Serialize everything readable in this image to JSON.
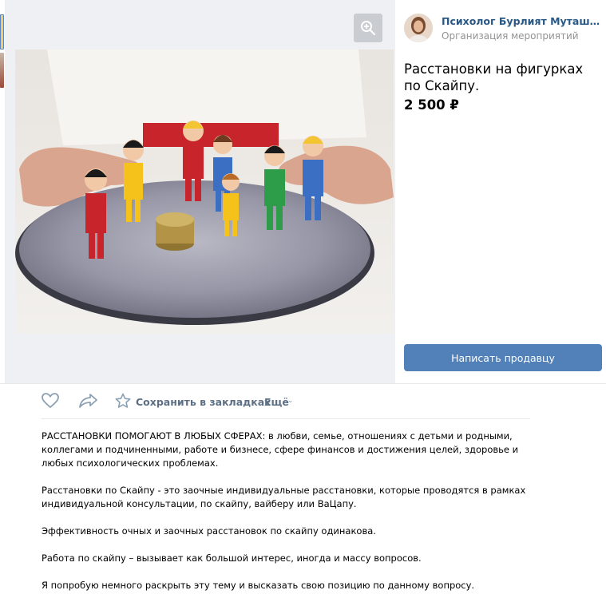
{
  "seller": {
    "name": "Психолог Бурлият Муташева г....",
    "subtitle": "Организация мероприятий"
  },
  "product": {
    "title": "Расстановки на фигурках по Скайпу.",
    "price": "2 500 ₽",
    "contact_button": "Написать продавцу"
  },
  "actions": {
    "like_icon": "heart-icon",
    "share_icon": "share-arrow-icon",
    "bookmark_icon": "star-icon",
    "bookmark_label": "Сохранить в закладках",
    "more_label": "Ещё"
  },
  "description": [
    "РАССТАНОВКИ ПОМОГАЮТ В ЛЮБЫХ СФЕРАХ: в любви, семье, отношениях с детьми и родными, коллегами и подчиненными, работе и бизнесе, сфере финансов и достижения целей, здоровье и любых психологических проблемах.",
    "Расстановки по Скайпу - это заочные индивидуальные расстановки, которые проводятся в рамках индивидуальной консультации, по скайпу, вайберу или ВаЦапу.",
    "Эффективность очных и заочных расстановок по скайпу одинакова.",
    "Работа по скайпу – вызывает как большой интерес, иногда и массу вопросов.",
    "Я попробую немного раскрыть эту тему и высказать свою позицию по данному вопросу."
  ],
  "colors": {
    "link": "#2a5885",
    "button": "#5181b8",
    "muted": "#939393"
  }
}
